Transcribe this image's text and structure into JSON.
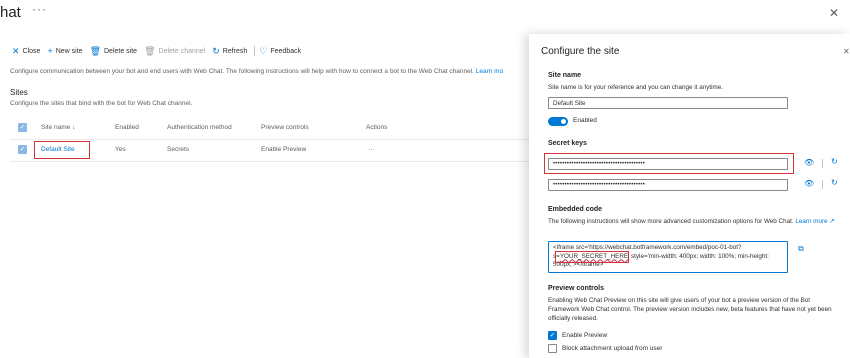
{
  "page": {
    "title": "hat",
    "more": "···",
    "close": "✕"
  },
  "toolbar": {
    "close": "Close",
    "new_site": "New site",
    "delete_site": "Delete site",
    "delete_channel": "Delete channel",
    "refresh": "Refresh",
    "feedback": "Feedback"
  },
  "description": {
    "text": "Configure communication between your bot and end users with Web Chat. The following instructions will help with how to connect a bot to the Web Chat channel.",
    "learn_more": "Learn mo"
  },
  "sites": {
    "heading": "Sites",
    "subheading": "Configure the sites that bind with the bot for Web Chat channel.",
    "columns": [
      "Site name ↓",
      "Enabled",
      "Authentication method",
      "Preview controls",
      "Actions"
    ],
    "rows": [
      {
        "name": "Default Site",
        "enabled": "Yes",
        "auth": "Secrets",
        "preview": "Enable Preview",
        "actions": "···"
      }
    ]
  },
  "panel": {
    "title": "Configure the site",
    "close": "✕",
    "site_name": {
      "heading": "Site name",
      "desc": "Site name is for your reference and you can change it anytime.",
      "value": "Default Site",
      "enabled_label": "Enabled"
    },
    "secret_keys": {
      "heading": "Secret keys",
      "key1": "••••••••••••••••••••••••••••••••••••••••",
      "key2": "••••••••••••••••••••••••••••••••••••••••"
    },
    "embedded_code": {
      "heading": "Embedded code",
      "desc": "The following instructions will show more advanced customization options for Web Chat.",
      "learn_more": "Learn more ↗",
      "code_line1": "<iframe src='https://webchat.botframework.com/embed/poc-01-bot?",
      "code_line2_prefix": "s=",
      "code_secret": "YOUR_SECRET_HERE'",
      "code_line2_suffix": " style='min-width: 400px; width: 100%; min-height:",
      "code_line3": "500px;'></iframe>"
    },
    "preview": {
      "heading": "Preview controls",
      "desc": "Enabling Web Chat Preview on this site will give users of your bot a preview version of the Bot Framework Web Chat control. The preview version includes new, beta features that have not yet been officially released.",
      "enable_preview": "Enable Preview",
      "block_attachment": "Block attachment upload from user"
    }
  },
  "icons": {
    "close": "close-icon",
    "add": "add-icon",
    "delete": "delete-icon",
    "refresh": "refresh-icon",
    "feedback": "feedback-icon",
    "eye": "eye-icon",
    "regenerate": "regenerate-icon",
    "copy": "copy-icon"
  },
  "colors": {
    "accent": "#0078d4",
    "highlight": "#d13438"
  }
}
